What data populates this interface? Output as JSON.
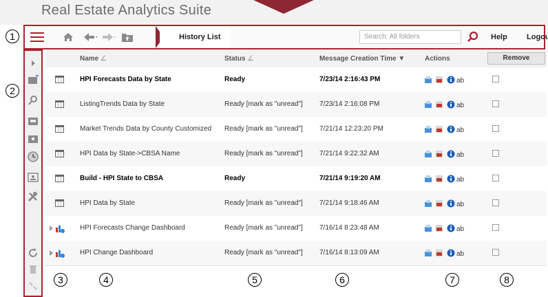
{
  "app": {
    "title": "Real Estate Analytics Suite"
  },
  "callouts": [
    "1",
    "2",
    "3",
    "4",
    "5",
    "6",
    "7",
    "8"
  ],
  "toolbar": {
    "breadcrumb": "History List",
    "search_placeholder": "Search: All folders",
    "help_label": "Help",
    "logout_label": "Logout"
  },
  "table": {
    "headers": {
      "name": "Name",
      "status": "Status",
      "time": "Message Creation Time",
      "actions": "Actions",
      "remove": "Remove"
    },
    "rows": [
      {
        "name": "HPI Forecasts Data by State",
        "status": "Ready",
        "time": "7/23/14 2:16:43 PM",
        "bold": true,
        "icon": "grid-report-icon"
      },
      {
        "name": "ListingTrends Data by State",
        "status": "Ready [mark as \"unread\"]",
        "time": "7/23/14 2:16:08 PM",
        "bold": false,
        "icon": "grid-report-icon"
      },
      {
        "name": "Market Trends Data by County Customized",
        "status": "Ready [mark as \"unread\"]",
        "time": "7/21/14 12:23:20 PM",
        "bold": false,
        "icon": "grid-report-icon"
      },
      {
        "name": "HPI Data by State->CBSA Name",
        "status": "Ready [mark as \"unread\"]",
        "time": "7/21/14 9:22:32 AM",
        "bold": false,
        "icon": "grid-report-icon"
      },
      {
        "name": "Build - HPI State to CBSA",
        "status": "Ready",
        "time": "7/21/14 9:19:20 AM",
        "bold": true,
        "icon": "grid-report-icon"
      },
      {
        "name": "HPI Data by State",
        "status": "Ready [mark as \"unread\"]",
        "time": "7/21/14 9:18:46 AM",
        "bold": false,
        "icon": "grid-report-icon"
      },
      {
        "name": "HPI Forecasts Change Dashboard",
        "status": "Ready [mark as \"unread\"]",
        "time": "7/16/14 8:23:48 AM",
        "bold": false,
        "icon": "dashboard-icon"
      },
      {
        "name": "HPI Change Dashboard",
        "status": "Ready [mark as \"unread\"]",
        "time": "7/16/14 8:13:09 AM",
        "bold": false,
        "icon": "dashboard-icon"
      }
    ]
  },
  "colors": {
    "accent": "#b01e2e",
    "brand": "#8f2633"
  },
  "icons": [
    "hamburger-menu-icon",
    "home-icon",
    "back-arrow-icon",
    "forward-arrow-icon",
    "folder-up-icon",
    "search-icon",
    "expand-arrow-icon",
    "new-document-icon",
    "search-sidebar-icon",
    "shared-folder-icon",
    "my-folder-icon",
    "history-clock-icon",
    "profile-icon",
    "tools-icon",
    "refresh-icon",
    "trash-icon",
    "collapse-icon"
  ]
}
